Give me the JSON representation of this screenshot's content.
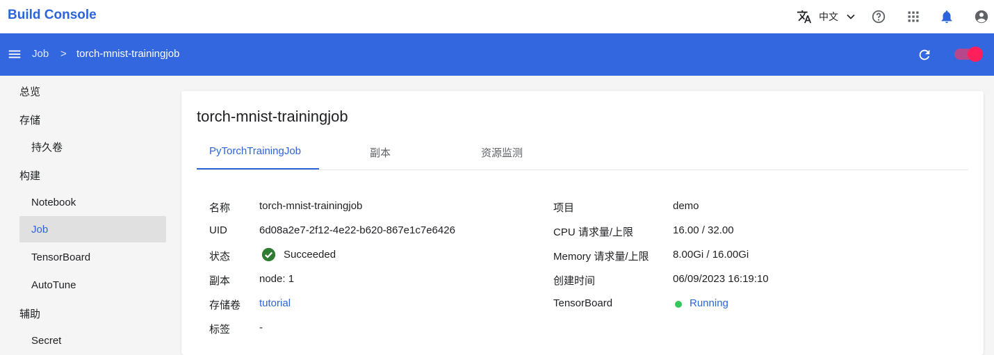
{
  "app": {
    "title": "Build Console"
  },
  "topbar": {
    "language_label": "中文"
  },
  "breadcrumb": {
    "parent": "Job",
    "separator": ">",
    "current": "torch-mnist-trainingjob"
  },
  "sidebar": {
    "sections": [
      {
        "label": "总览"
      },
      {
        "label": "存储",
        "items": [
          "持久卷"
        ]
      },
      {
        "label": "构建",
        "items": [
          "Notebook",
          "Job",
          "TensorBoard",
          "AutoTune"
        ]
      },
      {
        "label": "辅助",
        "items": [
          "Secret"
        ]
      }
    ],
    "active_item": "Job"
  },
  "detail": {
    "title": "torch-mnist-trainingjob",
    "tabs": [
      "PyTorchTrainingJob",
      "副本",
      "资源监测"
    ],
    "active_tab": "PyTorchTrainingJob",
    "left": [
      {
        "label": "名称",
        "value": "torch-mnist-trainingjob"
      },
      {
        "label": "UID",
        "value": "6d08a2e7-2f12-4e22-b620-867e1c7e6426"
      },
      {
        "label": "状态",
        "value": "Succeeded"
      },
      {
        "label": "副本",
        "value": "node: 1"
      },
      {
        "label": "存储卷",
        "value": "tutorial"
      },
      {
        "label": "标签",
        "value": "-"
      }
    ],
    "right": [
      {
        "label": "项目",
        "value": "demo"
      },
      {
        "label": "CPU 请求量/上限",
        "value": "16.00 / 32.00"
      },
      {
        "label": "Memory 请求量/上限",
        "value": "8.00Gi / 16.00Gi"
      },
      {
        "label": "创建时间",
        "value": "06/09/2023 16:19:10"
      },
      {
        "label": "TensorBoard",
        "value": "Running"
      }
    ]
  },
  "colors": {
    "brand": "#2b65d9",
    "appbar": "#3367e0",
    "success": "#2e7d32",
    "running": "#34c759",
    "toggle": "#ff1f5a"
  },
  "icons": {
    "translate": "translate-icon",
    "chevron": "chevron-down-icon",
    "help": "help-icon",
    "apps": "apps-grid-icon",
    "bell": "bell-icon",
    "account": "account-icon",
    "menu": "menu-icon",
    "refresh": "refresh-icon"
  }
}
